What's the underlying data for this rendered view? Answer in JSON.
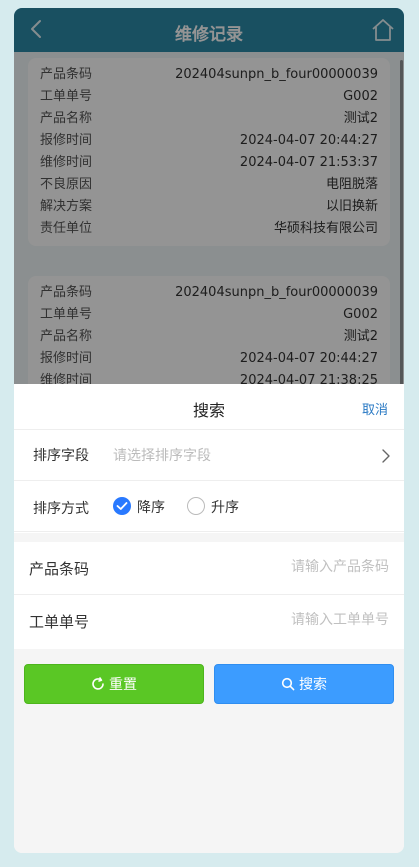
{
  "navbar": {
    "title": "维修记录"
  },
  "records": [
    {
      "fields": [
        {
          "label": "产品条码",
          "value": "202404sunpn_b_four00000039"
        },
        {
          "label": "工单单号",
          "value": "G002"
        },
        {
          "label": "产品名称",
          "value": "测试2"
        },
        {
          "label": "报修时间",
          "value": "2024-04-07 20:44:27"
        },
        {
          "label": "维修时间",
          "value": "2024-04-07 21:53:37"
        },
        {
          "label": "不良原因",
          "value": "电阻脱落"
        },
        {
          "label": "解决方案",
          "value": "以旧换新"
        },
        {
          "label": "责任单位",
          "value": "华硕科技有限公司"
        }
      ]
    },
    {
      "fields": [
        {
          "label": "产品条码",
          "value": "202404sunpn_b_four00000039"
        },
        {
          "label": "工单单号",
          "value": "G002"
        },
        {
          "label": "产品名称",
          "value": "测试2"
        },
        {
          "label": "报修时间",
          "value": "2024-04-07 20:44:27"
        },
        {
          "label": "维修时间",
          "value": "2024-04-07 21:38:25"
        }
      ]
    }
  ],
  "sheet": {
    "title": "搜索",
    "cancel_label": "取消",
    "sort_field": {
      "label": "排序字段",
      "placeholder": "请选择排序字段"
    },
    "sort_order": {
      "label": "排序方式",
      "options": [
        {
          "label": "降序",
          "checked": true
        },
        {
          "label": "升序",
          "checked": false
        }
      ]
    },
    "barcode": {
      "label": "产品条码",
      "placeholder": "请输入产品条码"
    },
    "order_no": {
      "label": "工单单号",
      "placeholder": "请输入工单单号"
    },
    "reset_label": "重置",
    "search_label": "搜索"
  },
  "colors": {
    "navbar": "#2c8aa8",
    "reset": "#5ac725",
    "search": "#3c9cff",
    "radio_on": "#2979ff",
    "cancel": "#2979c4"
  },
  "icons": {
    "back": "chevron-left-icon",
    "home": "home-icon",
    "chevron": "chevron-right-icon",
    "reset": "refresh-icon",
    "search": "search-icon"
  }
}
